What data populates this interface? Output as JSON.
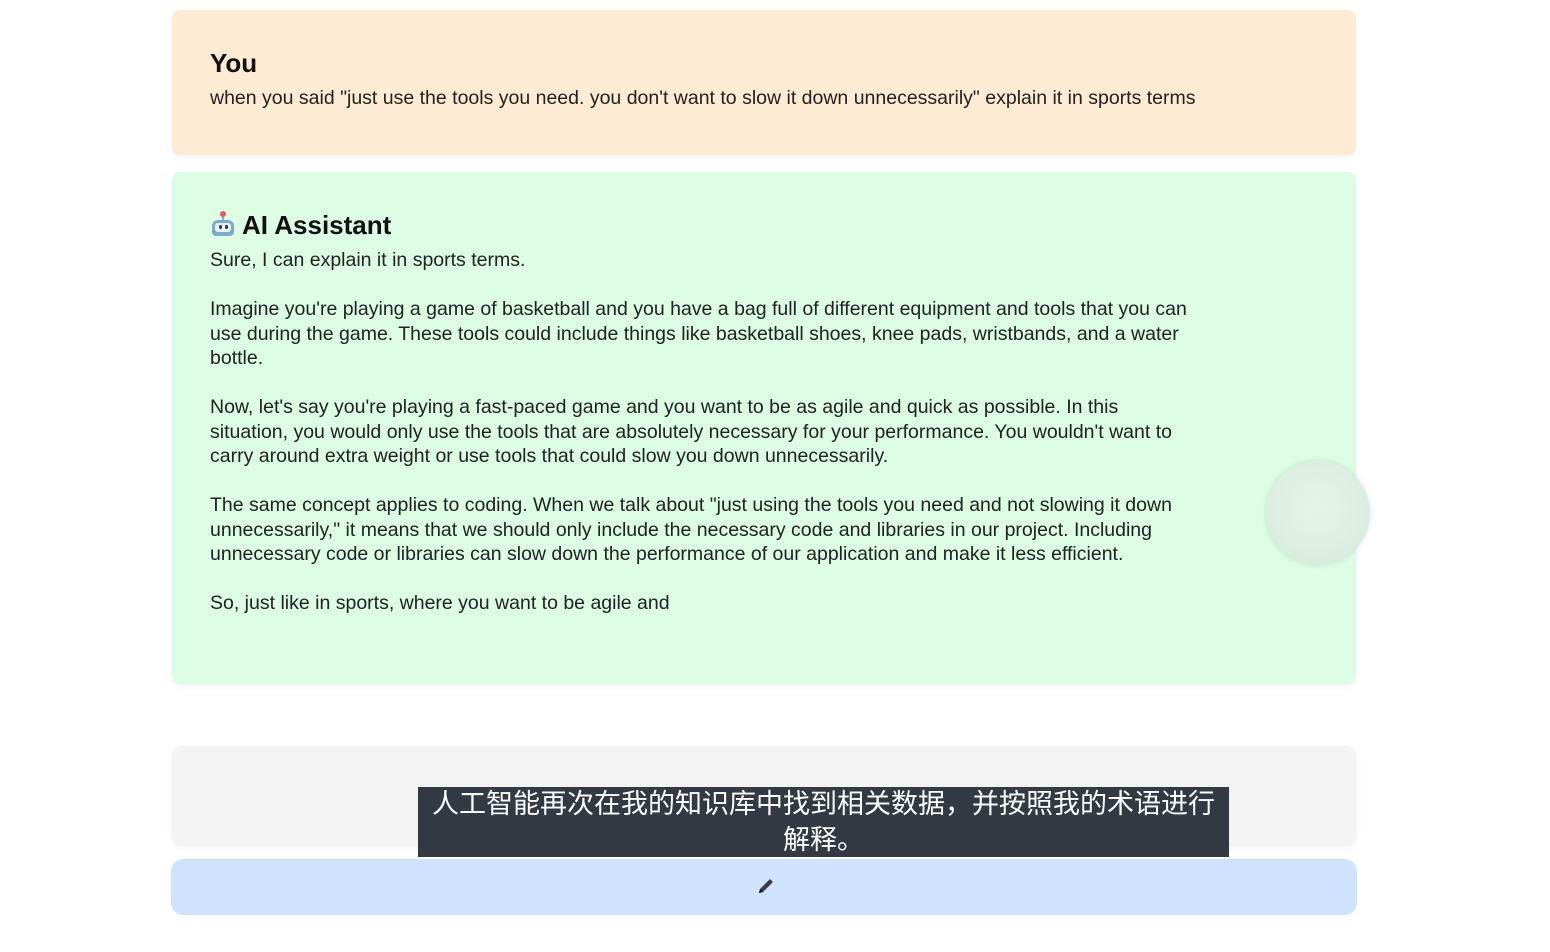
{
  "conversation": {
    "user_message": {
      "sender": "You",
      "text": "when you said \"just use the tools you need. you don't want to slow it down unnecessarily\" explain it in sports terms"
    },
    "assistant_message": {
      "icon": "robot-icon",
      "sender": "AI Assistant",
      "paragraphs": [
        "Sure, I can explain it in sports terms.",
        "Imagine you're playing a game of basketball and you have a bag full of different equipment and tools that you can use during the game. These tools could include things like basketball shoes, knee pads, wristbands, and a water bottle.",
        "Now, let's say you're playing a fast-paced game and you want to be as agile and quick as possible. In this situation, you would only use the tools that are absolutely necessary for your performance. You wouldn't want to carry around extra weight or use tools that could slow you down unnecessarily.",
        "The same concept applies to coding. When we talk about \"just using the tools you need and not slowing it down unnecessarily,\" it means that we should only include the necessary code and libraries in our project. Including unnecessary code or libraries can slow down the performance of our application and make it less efficient.",
        "So, just like in sports, where you want to be agile and"
      ]
    }
  },
  "input": {
    "value": "",
    "send_icon": "pencil-icon"
  },
  "subtitle": {
    "text": "人工智能再次在我的知识库中找到相关数据，并按照我的术语进行\n解释。"
  },
  "colors": {
    "user_bg": "#fdebd3",
    "assistant_bg": "#dcfce4",
    "input_bg": "#f3f3f4",
    "send_bg": "#cfe3fc",
    "subtitle_bg": "#333a44"
  }
}
